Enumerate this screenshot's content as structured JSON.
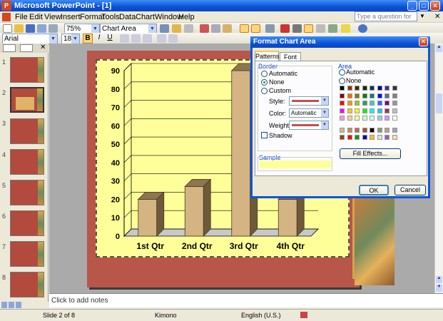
{
  "window": {
    "title": "Microsoft PowerPoint - [1]"
  },
  "menu": [
    "File",
    "Edit",
    "View",
    "Insert",
    "Format",
    "Tools",
    "Data",
    "Chart",
    "Window",
    "Help"
  ],
  "ask_placeholder": "Type a question for help",
  "toolbar": {
    "zoom": "75%",
    "chart_object": "Chart Area",
    "font": "Arial",
    "size": "18"
  },
  "thumbnails": [
    "1",
    "2",
    "3",
    "4",
    "5",
    "6",
    "7",
    "8"
  ],
  "notes_placeholder": "Click to add notes",
  "status": {
    "slide": "Slide 2 of 8",
    "design": "Kimono",
    "language": "English (U.S.)"
  },
  "chart_data": {
    "type": "bar",
    "categories": [
      "1st Qtr",
      "2nd Qtr",
      "3rd Qtr",
      "4th Qtr"
    ],
    "values": [
      20,
      27,
      90,
      20
    ],
    "ylim": [
      0,
      90
    ],
    "yticks": [
      "0",
      "10",
      "20",
      "30",
      "40",
      "50",
      "60",
      "70",
      "80",
      "90"
    ],
    "grid": true,
    "bar_color": "#d4b483",
    "background": "#ffff99"
  },
  "dialog": {
    "title": "Format Chart Area",
    "tabs": [
      "Patterns",
      "Font"
    ],
    "border_label": "Border",
    "border_options": [
      "Automatic",
      "None",
      "Custom"
    ],
    "style_label": "Style:",
    "color_label": "Color:",
    "color_value": "Automatic",
    "weight_label": "Weight:",
    "shadow_label": "Shadow",
    "sample_label": "Sample",
    "area_label": "Area",
    "area_options": [
      "Automatic",
      "None"
    ],
    "fill_effects": "Fill Effects...",
    "ok": "OK",
    "cancel": "Cancel"
  }
}
